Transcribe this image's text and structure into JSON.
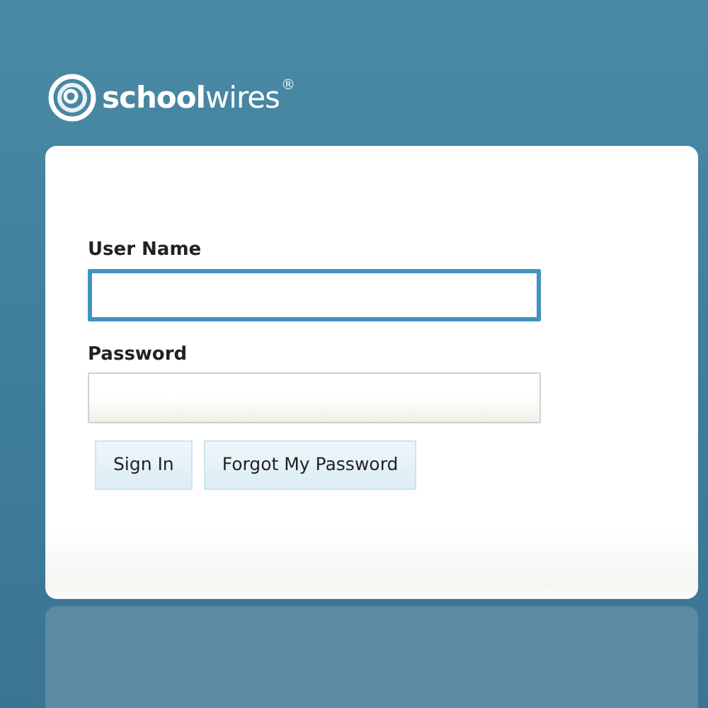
{
  "logo": {
    "wordmark": "**school**wires",
    "trademark": "®"
  },
  "form": {
    "fields": [
      {
        "label": "User Name",
        "focused": true
      },
      {
        "label": "Password",
        "focused": false
      }
    ],
    "buttons": [
      "Sign In",
      "Forgot My Password"
    ]
  }
}
